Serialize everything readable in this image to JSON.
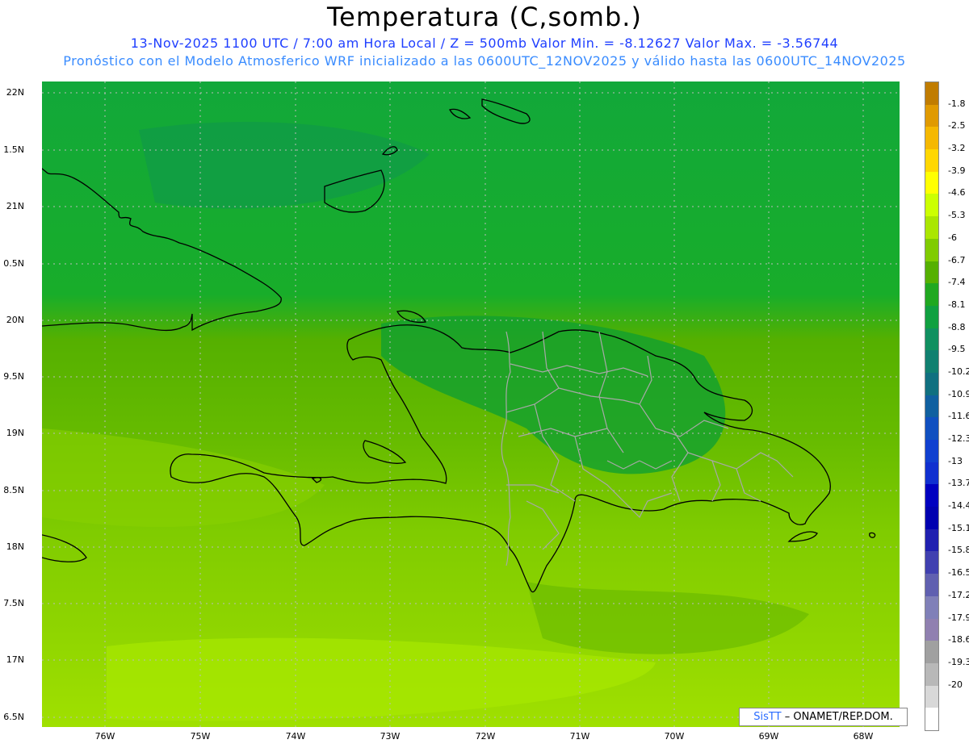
{
  "header": {
    "title": "Temperatura (C,somb.)",
    "subtitle1": "13-Nov-2025  1100 UTC / 7:00 am Hora Local / Z = 500mb  Valor Min. = -8.12627  Valor Max. = -3.56744",
    "subtitle2": "Pronóstico con el Modelo Atmosferico WRF inicializado a las 0600UTC_12NOV2025 y válido hasta las  0600UTC_14NOV2025"
  },
  "axes": {
    "lat_labels": [
      "22N",
      "1.5N",
      "21N",
      "0.5N",
      "20N",
      "9.5N",
      "19N",
      "8.5N",
      "18N",
      "7.5N",
      "17N",
      "6.5N"
    ],
    "lon_labels": [
      "76W",
      "75W",
      "74W",
      "73W",
      "72W",
      "71W",
      "70W",
      "69W",
      "68W"
    ]
  },
  "credit": {
    "logo": "SisTT",
    "text": "– ONAMET/REP.DOM."
  },
  "colorbar": {
    "labels": [
      "-1.8",
      "-2.5",
      "-3.2",
      "-3.9",
      "-4.6",
      "-5.3",
      "-6",
      "-6.7",
      "-7.4",
      "-8.1",
      "-8.8",
      "-9.5",
      "-10.2",
      "-10.9",
      "-11.6",
      "-12.3",
      "-13",
      "-13.7",
      "-14.4",
      "-15.1",
      "-15.8",
      "-16.5",
      "-17.2",
      "-17.9",
      "-18.6",
      "-19.3",
      "-20"
    ],
    "colors": [
      "#c07c00",
      "#e09a00",
      "#f5b800",
      "#ffd700",
      "#ffff00",
      "#ccff00",
      "#aae600",
      "#80cc00",
      "#55b000",
      "#20a820",
      "#10a040",
      "#109060",
      "#108070",
      "#107080",
      "#1060a0",
      "#1050c0",
      "#1040d0",
      "#1030d0",
      "#0000c0",
      "#0000b0",
      "#2020b0",
      "#4040b0",
      "#6060b0",
      "#8080b8",
      "#9080b0",
      "#a0a0a0",
      "#b8b8b8",
      "#d8d8d8",
      "#ffffff"
    ]
  }
}
